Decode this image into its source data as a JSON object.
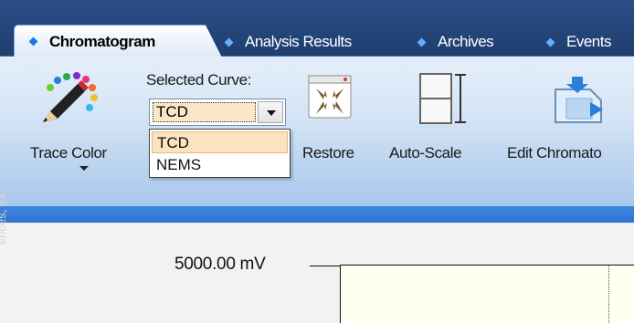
{
  "tabs": [
    {
      "label": "Chromatogram",
      "active": true
    },
    {
      "label": "Analysis Results",
      "active": false
    },
    {
      "label": "Archives",
      "active": false
    },
    {
      "label": "Events",
      "active": false
    }
  ],
  "ribbon": {
    "trace_color": {
      "label": "Trace Color",
      "icon": "pencil-palette-icon"
    },
    "selected_curve": {
      "label": "Selected Curve:",
      "value": "TCD",
      "options": [
        "TCD",
        "NEMS"
      ]
    },
    "restore": {
      "label": "Restore",
      "icon": "collapse-arrows-icon"
    },
    "auto_scale": {
      "label": "Auto-Scale",
      "icon": "auto-scale-icon"
    },
    "edit_chromatogram": {
      "label": "Edit Chromato",
      "icon": "edit-chromatogram-icon"
    }
  },
  "plot": {
    "y_max_label": "5000.00 mV",
    "watermark": "ences, Inc."
  },
  "colors": {
    "tab_strip": "#1f3e70",
    "ribbon_band": "#2f74d2",
    "selection": "#fbe3bf",
    "plot_background": "#fffff2"
  }
}
